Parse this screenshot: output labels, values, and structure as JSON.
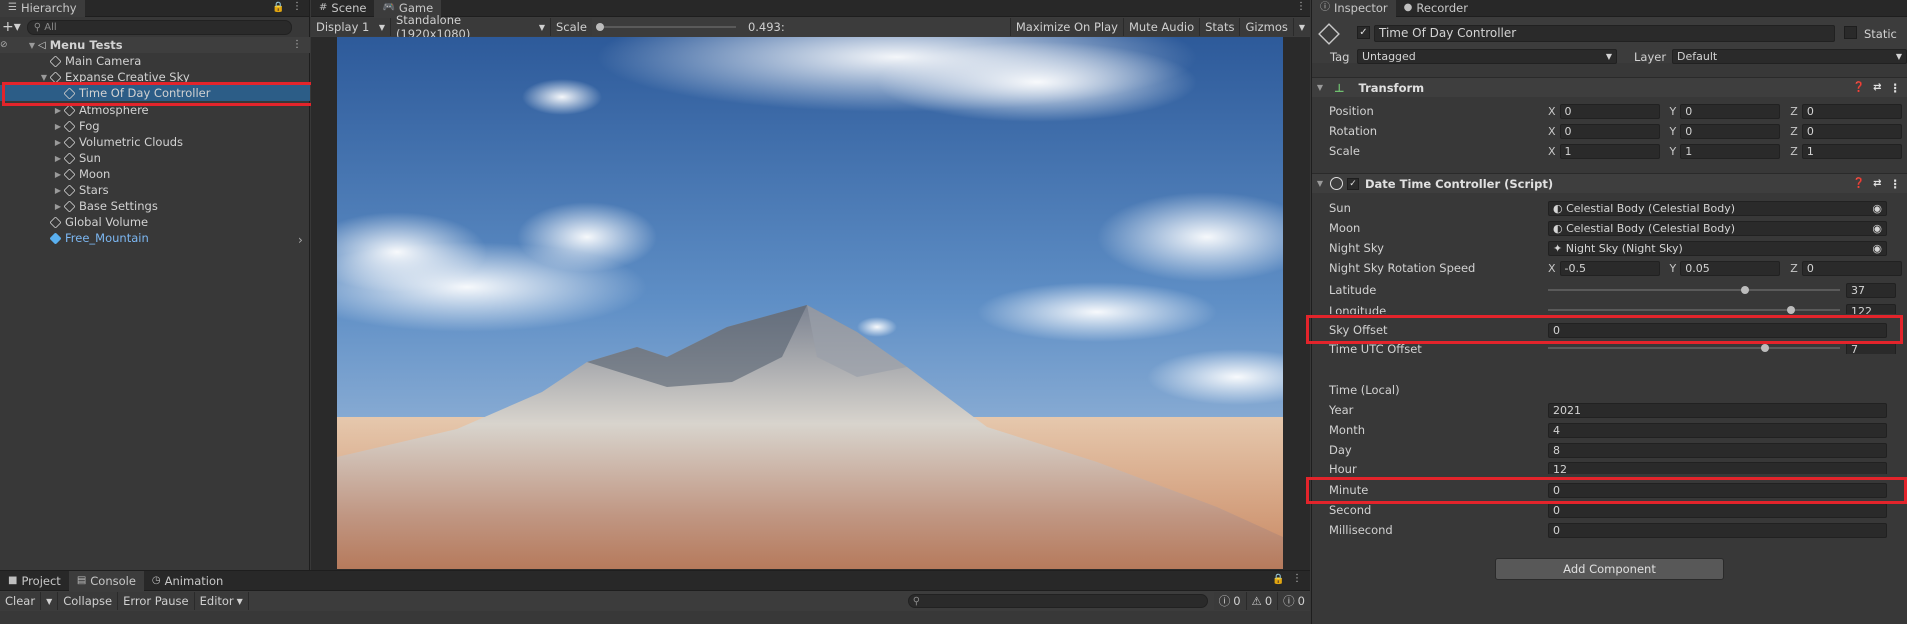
{
  "hierarchy": {
    "tab": "Hierarchy",
    "search_placeholder": "All",
    "scene": "Menu Tests",
    "items": [
      {
        "label": "Main Camera",
        "depth": 1,
        "expander": ""
      },
      {
        "label": "Expanse Creative Sky",
        "depth": 1,
        "expander": "▼"
      },
      {
        "label": "Time Of Day Controller",
        "depth": 2,
        "expander": "",
        "selected": true
      },
      {
        "label": "Atmosphere",
        "depth": 2,
        "expander": "▶"
      },
      {
        "label": "Fog",
        "depth": 2,
        "expander": "▶"
      },
      {
        "label": "Volumetric Clouds",
        "depth": 2,
        "expander": "▶"
      },
      {
        "label": "Sun",
        "depth": 2,
        "expander": "▶"
      },
      {
        "label": "Moon",
        "depth": 2,
        "expander": "▶"
      },
      {
        "label": "Stars",
        "depth": 2,
        "expander": "▶"
      },
      {
        "label": "Base Settings",
        "depth": 2,
        "expander": "▶"
      },
      {
        "label": "Global Volume",
        "depth": 1,
        "expander": ""
      },
      {
        "label": "Free_Mountain",
        "depth": 1,
        "expander": "",
        "prefab": true
      }
    ]
  },
  "game": {
    "tabs": [
      "Scene",
      "Game"
    ],
    "display": "Display 1",
    "resolution": "Standalone (1920x1080)",
    "scale_label": "Scale",
    "scale_value": "0.493:",
    "maximize": "Maximize On Play",
    "mute": "Mute Audio",
    "stats": "Stats",
    "gizmos": "Gizmos"
  },
  "bottom": {
    "tabs": [
      "Project",
      "Console",
      "Animation"
    ],
    "clear": "Clear",
    "collapse": "Collapse",
    "error_pause": "Error Pause",
    "editor": "Editor",
    "counts": [
      "0",
      "0",
      "0"
    ]
  },
  "inspector": {
    "tabs": [
      "Inspector",
      "Recorder"
    ],
    "object_name": "Time Of Day Controller",
    "static_label": "Static",
    "tag_label": "Tag",
    "tag_value": "Untagged",
    "layer_label": "Layer",
    "layer_value": "Default",
    "transform": {
      "title": "Transform",
      "position": {
        "label": "Position",
        "x": "0",
        "y": "0",
        "z": "0"
      },
      "rotation": {
        "label": "Rotation",
        "x": "0",
        "y": "0",
        "z": "0"
      },
      "scale": {
        "label": "Scale",
        "x": "1",
        "y": "1",
        "z": "1"
      }
    },
    "script": {
      "title": "Date Time Controller (Script)",
      "sun": {
        "label": "Sun",
        "value": "Celestial Body (Celestial Body)"
      },
      "moon": {
        "label": "Moon",
        "value": "Celestial Body (Celestial Body)"
      },
      "night_sky": {
        "label": "Night Sky",
        "value": "Night Sky (Night Sky)"
      },
      "night_sky_rotation": {
        "label": "Night Sky Rotation Speed",
        "x": "-0.5",
        "y": "0.05",
        "z": "0"
      },
      "latitude": {
        "label": "Latitude",
        "value": "37",
        "fraction": 0.68
      },
      "longitude": {
        "label": "Longitude",
        "value": "122",
        "fraction": 0.84
      },
      "sky_offset": {
        "label": "Sky Offset",
        "value": "0"
      },
      "time_utc_offset": {
        "label": "Time UTC Offset",
        "value": "7",
        "fraction": 0.75
      },
      "time_local_header": "Time (Local)",
      "year": {
        "label": "Year",
        "value": "2021"
      },
      "month": {
        "label": "Month",
        "value": "4"
      },
      "day": {
        "label": "Day",
        "value": "8"
      },
      "hour": {
        "label": "Hour",
        "value": "12"
      },
      "minute": {
        "label": "Minute",
        "value": "0"
      },
      "second": {
        "label": "Second",
        "value": "0"
      },
      "millisecond": {
        "label": "Millisecond",
        "value": "0"
      }
    },
    "add_component": "Add Component"
  },
  "colors": {
    "highlight": "#e3242b",
    "selection": "#2c5d87",
    "prefab_text": "#7cb7f2"
  }
}
